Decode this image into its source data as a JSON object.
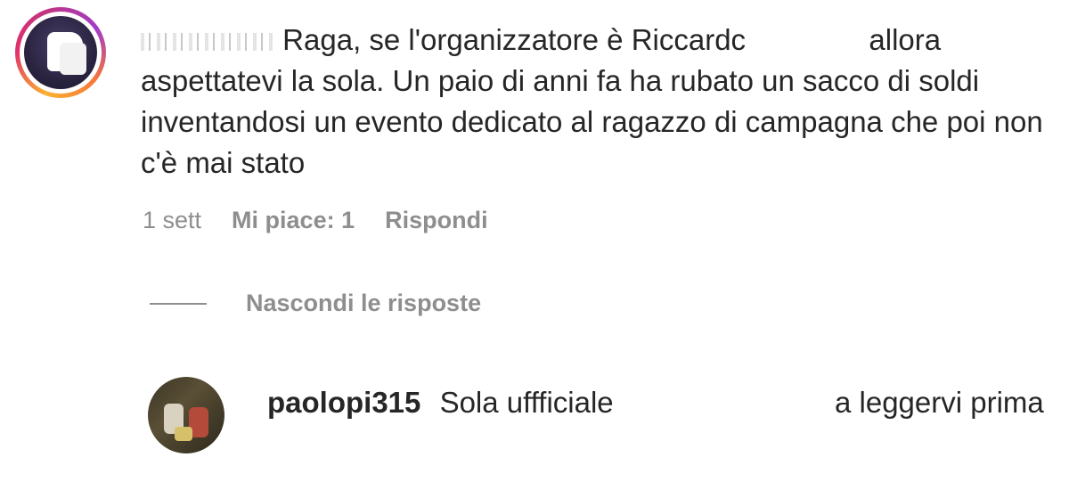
{
  "comment": {
    "text_line1_a": "Raga, se l'organizzatore è Riccardc",
    "text_line1_b": "allora",
    "text_rest": "aspettatevi la sola. Un paio di anni fa ha rubato un sacco di soldi inventandosi un evento dedicato al ragazzo di campagna che poi non c'è mai stato",
    "time": "1 sett",
    "likes": "Mi piace: 1",
    "reply": "Rispondi"
  },
  "thread": {
    "hide_replies": "Nascondi le risposte"
  },
  "reply": {
    "username": "paolopi315",
    "text_a": "Sola uffficiale",
    "text_b": "a leggervi prima"
  }
}
